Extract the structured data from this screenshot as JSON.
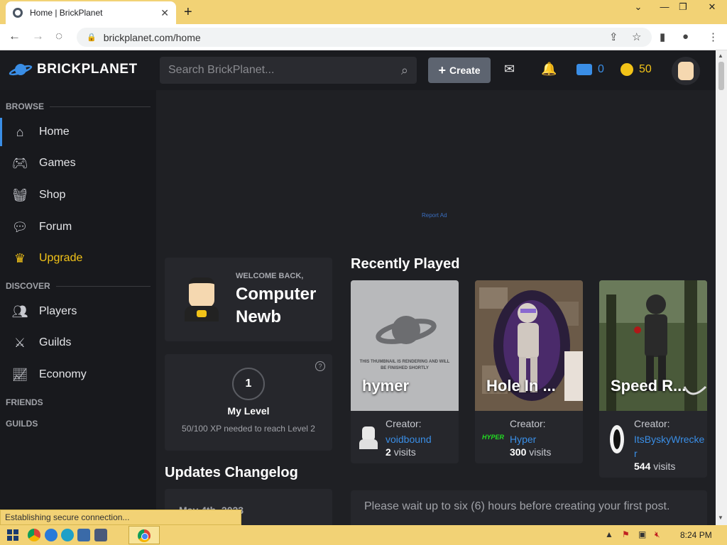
{
  "browser": {
    "tab_title": "Home | BrickPlanet",
    "url": "brickplanet.com/home",
    "new_tab": "+",
    "close_tab": "✕"
  },
  "header": {
    "logo_text": "BRICKPLANET",
    "search_placeholder": "Search BrickPlanet...",
    "create_label": "Create",
    "bucks": "0",
    "bits": "50",
    "colors": {
      "accent": "#3a8ee6",
      "gold": "#f2c318",
      "header_bg": "#1a1b1f"
    }
  },
  "sidebar": {
    "sections": {
      "browse": "BROWSE",
      "discover": "DISCOVER",
      "friends": "FRIENDS",
      "guilds": "GUILDS"
    },
    "items": [
      {
        "label": "Home",
        "icon": "home-icon"
      },
      {
        "label": "Games",
        "icon": "gamepad-icon"
      },
      {
        "label": "Shop",
        "icon": "basket-icon"
      },
      {
        "label": "Forum",
        "icon": "chat-icon"
      },
      {
        "label": "Upgrade",
        "icon": "crown-icon"
      },
      {
        "label": "Players",
        "icon": "users-icon"
      },
      {
        "label": "Guilds",
        "icon": "swords-icon"
      },
      {
        "label": "Economy",
        "icon": "chart-icon"
      }
    ]
  },
  "main": {
    "report_ad": "Report Ad",
    "welcome": {
      "greeting": "WELCOME BACK,",
      "name": "Computer Newb"
    },
    "level": {
      "number": "1",
      "label": "My Level",
      "xp_text": "50/100 XP needed to reach Level 2",
      "help": "?"
    },
    "changelog": {
      "title": "Updates Changelog",
      "date": "May 4th, 2023"
    },
    "recently_played": {
      "title": "Recently Played",
      "creator_label": "Creator:",
      "visits_word": "visits",
      "placeholder_text": "THIS THUMBNAIL IS RENDERING AND WILL BE FINISHED SHORTLY",
      "games": [
        {
          "name": "hymer",
          "creator": "voidbound",
          "visits": "2"
        },
        {
          "name": "Hole In ...",
          "creator": "Hyper",
          "visits": "300"
        },
        {
          "name": "Speed R...",
          "creator": "ItsByskyWrecker",
          "visits": "544"
        }
      ]
    },
    "notice": "Please wait up to six (6) hours before creating your first post."
  },
  "status": "Establishing secure connection...",
  "taskbar": {
    "clock": "8:24 PM"
  }
}
